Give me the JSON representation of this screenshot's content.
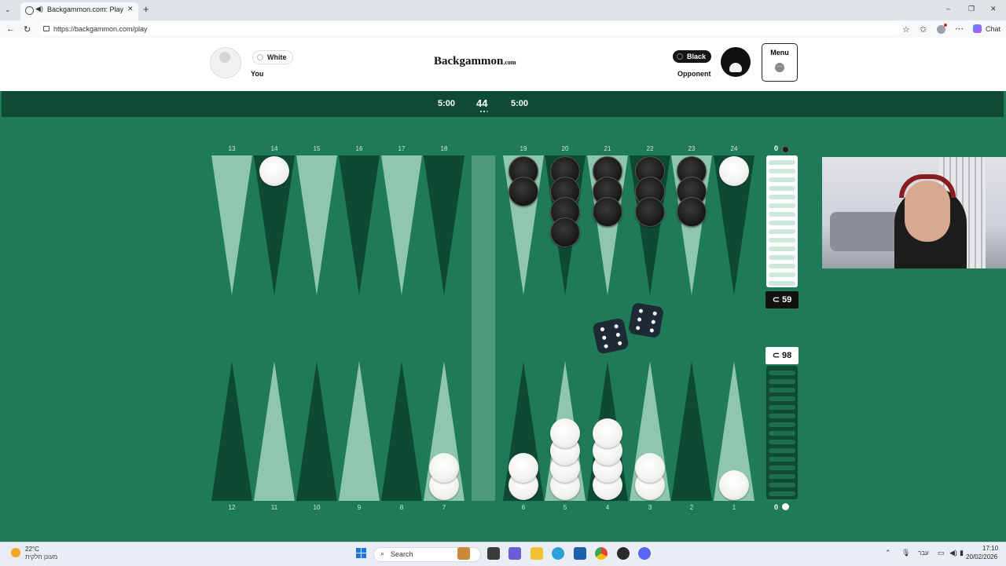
{
  "browser": {
    "tab_title": "Backgammon.com: Play Onlin",
    "url": "https://backgammon.com/play",
    "new_tab": "+",
    "chat_label": "Chat"
  },
  "header": {
    "player": {
      "color_label": "White",
      "name": "You"
    },
    "opponent": {
      "color_label": "Black",
      "name": "Opponent"
    },
    "logo_main": "Backgammon",
    "logo_suffix": ".com",
    "menu_label": "Menu",
    "menu_dots": "⋯"
  },
  "timers": {
    "left": "5:00",
    "match": "44",
    "right": "5:00"
  },
  "board": {
    "top_points": [
      "13",
      "14",
      "15",
      "16",
      "17",
      "18",
      "19",
      "20",
      "21",
      "22",
      "23",
      "24"
    ],
    "bottom_points": [
      "12",
      "11",
      "10",
      "9",
      "8",
      "7",
      "6",
      "5",
      "4",
      "3",
      "2",
      "1"
    ],
    "checkers_top": {
      "14": {
        "color": "white",
        "count": 1
      },
      "19": {
        "color": "black",
        "count": 2
      },
      "20": {
        "color": "black",
        "count": 4
      },
      "21": {
        "color": "black",
        "count": 3
      },
      "22": {
        "color": "black",
        "count": 3
      },
      "23": {
        "color": "black",
        "count": 3
      },
      "24": {
        "color": "white",
        "count": 1
      }
    },
    "checkers_bottom": {
      "7": {
        "color": "white",
        "count": 2
      },
      "6": {
        "color": "white",
        "count": 2
      },
      "5": {
        "color": "white",
        "count": 4
      },
      "4": {
        "color": "white",
        "count": 4
      },
      "3": {
        "color": "white",
        "count": 2
      },
      "1": {
        "color": "white",
        "count": 1
      }
    },
    "dice": [
      6,
      6
    ],
    "tray_top": {
      "borne_off": "0",
      "pip": "59",
      "pip_prefix": "⊂"
    },
    "tray_bottom": {
      "borne_off": "0",
      "pip": "98",
      "pip_prefix": "⊂"
    }
  },
  "taskbar": {
    "weather_temp": "22°C",
    "weather_desc": "מעונן חלקית",
    "search": "Search",
    "lang": "עבר",
    "time": "17:10",
    "date": "20/02/2026"
  },
  "colors": {
    "felt": "#1f7a57",
    "dark_point": "#0e4a33",
    "light_point": "#8fc6ae",
    "bar": "#4e9b7c",
    "timer_bar": "#0f4a34"
  }
}
